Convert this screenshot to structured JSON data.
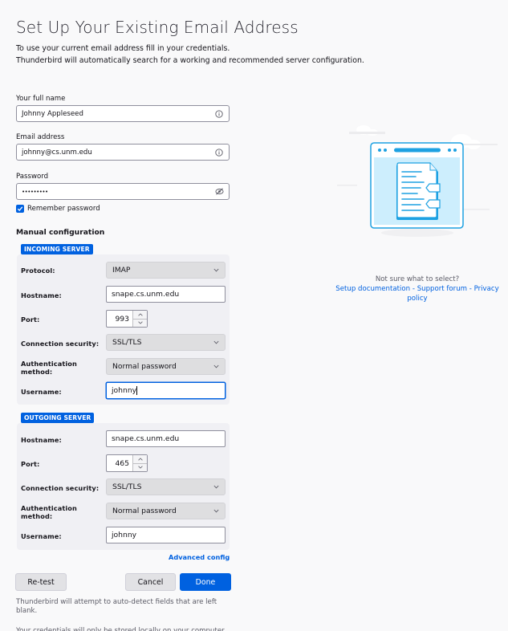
{
  "header": {
    "title": "Set Up Your Existing Email Address",
    "subtitle_line1": "To use your current email address fill in your credentials.",
    "subtitle_line2": "Thunderbird will automatically search for a working and recommended server configuration."
  },
  "form": {
    "full_name": {
      "label": "Your full name",
      "value": "Johnny Appleseed",
      "icon": "info-icon"
    },
    "email": {
      "label": "Email address",
      "value": "johnny@cs.unm.edu",
      "icon": "info-icon"
    },
    "password": {
      "label": "Password",
      "value": "•••••••••",
      "icon": "eye-slash-icon"
    },
    "remember": {
      "label": "Remember password",
      "checked": true
    }
  },
  "manual": {
    "title": "Manual configuration",
    "incoming": {
      "badge": "INCOMING SERVER",
      "protocol_label": "Protocol:",
      "protocol": "IMAP",
      "hostname_label": "Hostname:",
      "hostname": "snape.cs.unm.edu",
      "port_label": "Port:",
      "port": "993",
      "security_label": "Connection security:",
      "security": "SSL/TLS",
      "auth_label_1": "Authentication",
      "auth_label_2": "method:",
      "auth": "Normal password",
      "username_label": "Username:",
      "username": "johnny"
    },
    "outgoing": {
      "badge": "OUTGOING SERVER",
      "hostname_label": "Hostname:",
      "hostname": "snape.cs.unm.edu",
      "port_label": "Port:",
      "port": "465",
      "security_label": "Connection security:",
      "security": "SSL/TLS",
      "auth_label_1": "Authentication",
      "auth_label_2": "method:",
      "auth": "Normal password",
      "username_label": "Username:",
      "username": "johnny"
    },
    "advanced_label": "Advanced config"
  },
  "actions": {
    "retest": "Re-test",
    "cancel": "Cancel",
    "done": "Done"
  },
  "notes": {
    "autodetect": "Thunderbird will attempt to auto-detect fields that are left blank.",
    "credentials": "Your credentials will only be stored locally on your computer."
  },
  "help": {
    "question": "Not sure what to select?",
    "setup_docs": "Setup documentation",
    "separator": " - ",
    "support_forum": "Support forum",
    "privacy_policy": "Privacy policy"
  },
  "colors": {
    "accent": "#0061e0",
    "background": "#f9f9fa",
    "panel": "#f0f0f4",
    "illustration": "#1da1e2"
  }
}
